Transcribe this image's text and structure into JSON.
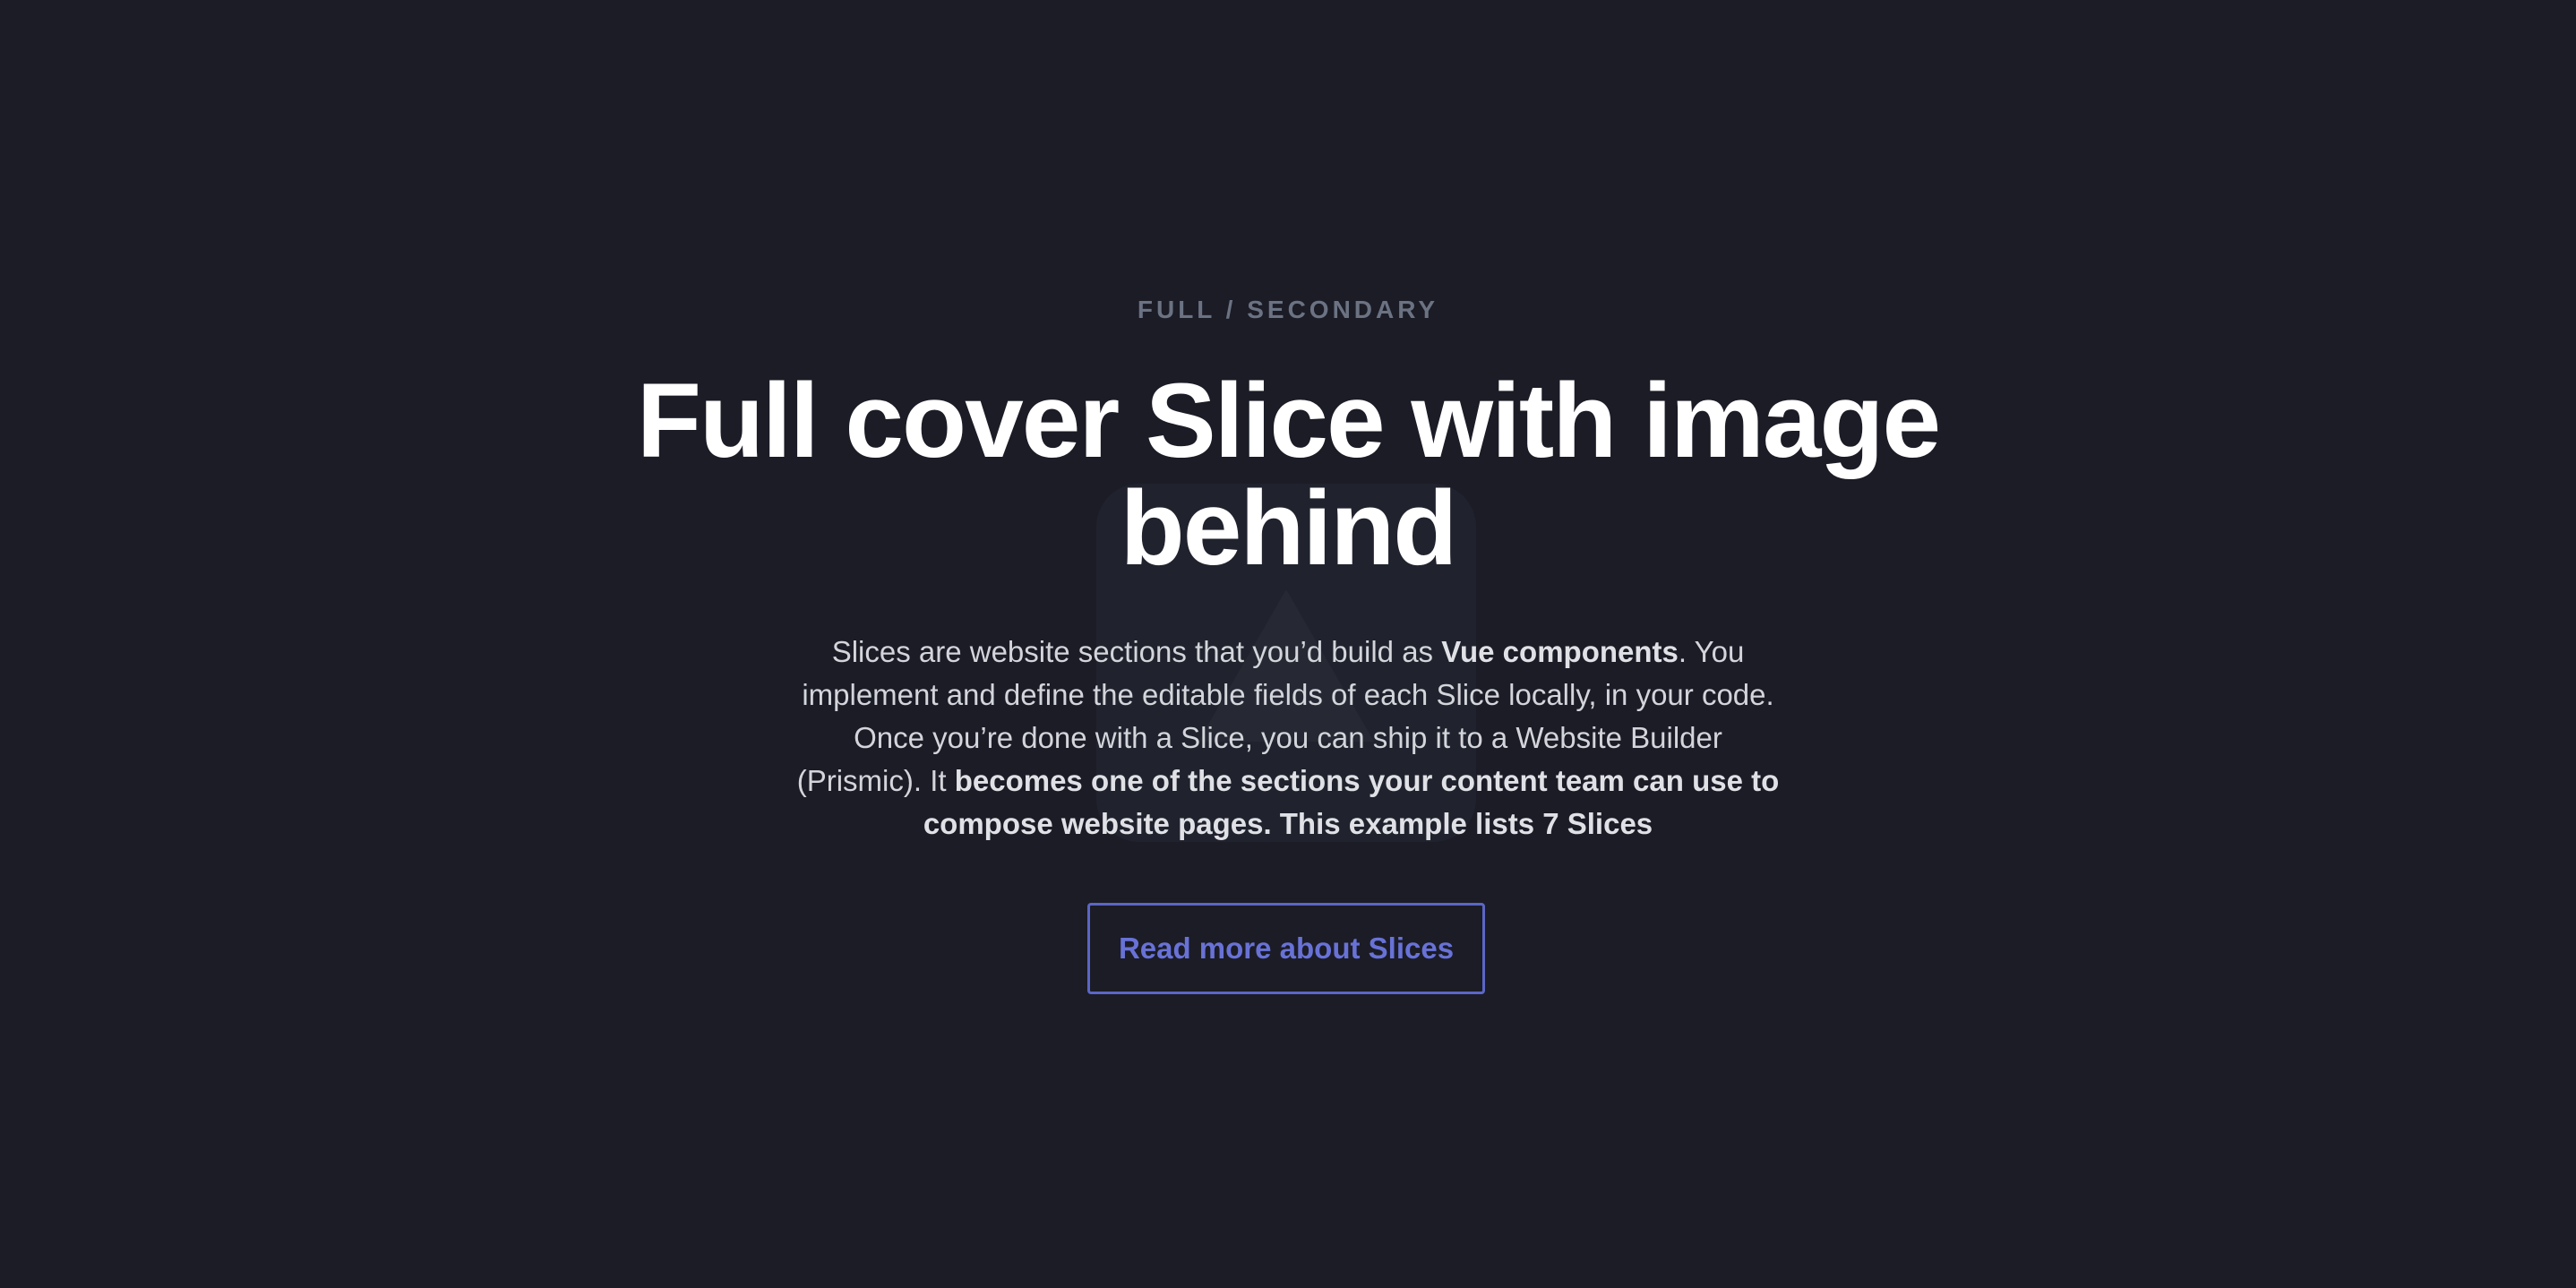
{
  "hero": {
    "eyebrow": "FULL / SECONDARY",
    "title": "Full cover Slice with image behind",
    "description": {
      "part1": "Slices are website sections that you’d build as ",
      "bold1": "Vue components",
      "part2": ". You implement and define the editable fields of each Slice locally, in your code. Once you’re done with a Slice, you can ship it to a Website Builder (Prismic). It ",
      "bold2": "becomes one of the sections your content team can use to compose website pages. This example lists 7 Slices"
    },
    "cta_label": "Read more about Slices",
    "background_icon": "vue-logo-icon"
  },
  "colors": {
    "background": "#1b1c26",
    "eyebrow": "#6b7383",
    "title": "#ffffff",
    "text": "#d3d5db",
    "accent": "#5b66c7"
  }
}
